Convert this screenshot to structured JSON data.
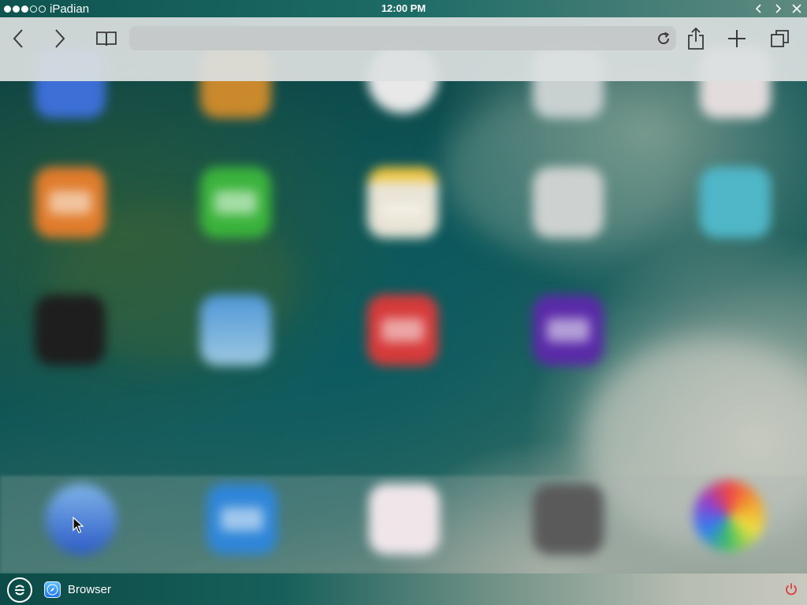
{
  "window": {
    "app_name": "iPadian",
    "clock": "12:00 PM",
    "signal_icon": "signal-dots-icon",
    "controls": [
      {
        "name": "previous-window-button",
        "icon": "chevron-left-icon"
      },
      {
        "name": "next-window-button",
        "icon": "chevron-right-icon"
      },
      {
        "name": "close-window-button",
        "icon": "close-icon"
      }
    ]
  },
  "toolbar": {
    "back_icon": "chevron-left-icon",
    "forward_icon": "chevron-right-icon",
    "bookmarks_icon": "open-book-icon",
    "address_value": "",
    "address_placeholder": "",
    "reload_icon": "reload-icon",
    "share_icon": "share-icon",
    "new_tab_icon": "plus-icon",
    "tabs_icon": "tabs-icon"
  },
  "taskbar": {
    "start_icon": "ipadian-logo-icon",
    "task_label": "Browser",
    "task_icon": "safari-compass-icon",
    "power_icon": "power-icon"
  },
  "colors": {
    "toolbar_bg": "#dcE0e0",
    "icon_color": "#333333",
    "power_red": "#e03a3a",
    "wallpaper_teal": "#0f5556"
  }
}
